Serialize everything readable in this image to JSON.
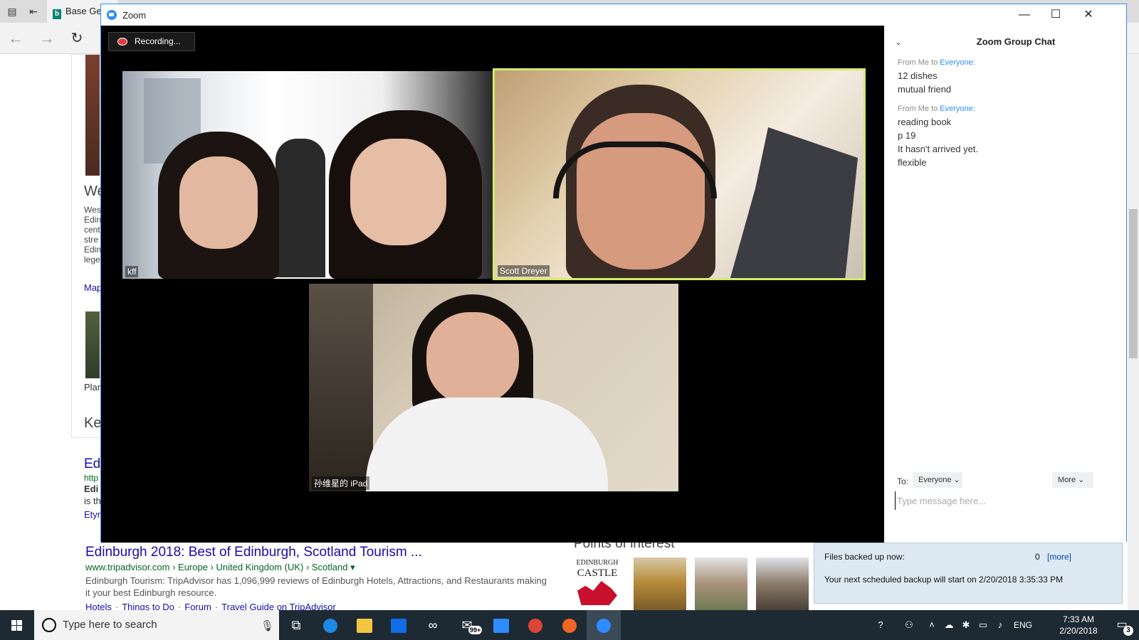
{
  "browser": {
    "tab_label": "Base Ge",
    "page_fragments": {
      "w1": "We",
      "desc": [
        "Wes",
        "Edin",
        "cent",
        "stre",
        "Edin",
        "lege"
      ],
      "map": "Map",
      "plan": "Plar",
      "ke": "Ke",
      "ed": "Ed",
      "http": "http",
      "edi": "Edi",
      "isth": "is th",
      "etym": "Etyr"
    },
    "result": {
      "title": "Edinburgh 2018: Best of Edinburgh, Scotland Tourism ...",
      "url": "www.tripadvisor.com › Europe › United Kingdom (UK) › Scotland ▾",
      "snippet": "Edinburgh Tourism: TripAdvisor has 1,096,999 reviews of Edinburgh Hotels, Attractions, and Restaurants making it your best Edinburgh resource.",
      "links": [
        "Hotels",
        "Things to Do",
        "Forum",
        "Travel Guide on TripAdvisor"
      ]
    },
    "poi_title": "Points of interest",
    "castle_logo": [
      "EDINBURGH",
      "CASTLE"
    ],
    "backup": {
      "files_label": "Files backed up now:",
      "files_count": "0",
      "more": "[more]",
      "next": "Your next scheduled backup will start on  2/20/2018 3:35:33 PM"
    }
  },
  "zoom": {
    "window_title": "Zoom",
    "recording_label": "Recording...",
    "participants": [
      {
        "name": "kff"
      },
      {
        "name": "Scott Dreyer"
      },
      {
        "name": "孙维星的 iPad"
      }
    ],
    "chat": {
      "title": "Zoom Group Chat",
      "messages": [
        {
          "from": "From Me to ",
          "to": "Everyone:",
          "lines": [
            "12 dishes",
            "mutual friend"
          ]
        },
        {
          "from": "From Me to ",
          "to": "Everyone:",
          "lines": [
            "reading book",
            "p 19",
            "It hasn't arrived yet.",
            "flexible"
          ]
        }
      ],
      "to_label": "To:",
      "to_value": "Everyone",
      "more_label": "More",
      "input_placeholder": "Type message here..."
    }
  },
  "taskbar": {
    "search_placeholder": "Type here to search",
    "mail_badge": "99+",
    "language": "ENG",
    "time": "7:33 AM",
    "date": "2/20/2018",
    "notification_count": "3"
  },
  "colors": {
    "zoom_blue": "#2d8cff",
    "active_speaker": "#d5ea6b",
    "taskbar": "#1e2a33",
    "record_red": "#e23b3b"
  }
}
